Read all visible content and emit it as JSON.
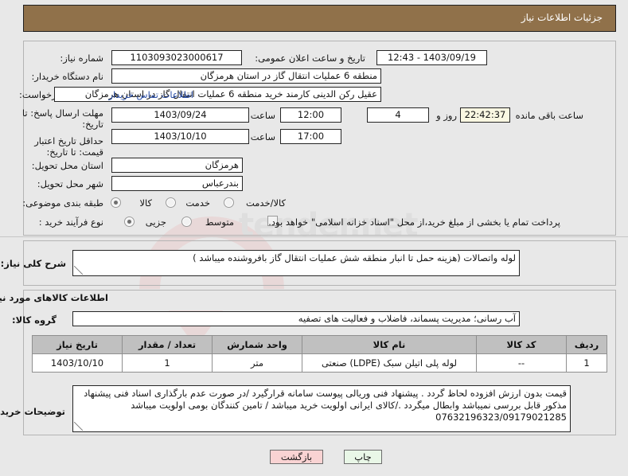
{
  "header": {
    "title": "جزئیات اطلاعات نیاز"
  },
  "request_info": {
    "need_number_label": "شماره نیاز:",
    "need_number_value": "1103093023000617",
    "announce_datetime_label": "تاریخ و ساعت اعلان عمومی:",
    "announce_datetime_value": "1403/09/19 - 12:43",
    "buyer_org_label": "نام دستگاه خریدار:",
    "buyer_org_value": "منطقه 6 عملیات انتقال گاز در استان هرمزگان",
    "requester_label": "ایجاد کننده درخواست:",
    "requester_value": "عقیل رکن الدینی کارمند خرید منطقه 6 عملیات انتقال گاز در استان هرمزگان",
    "buyer_contact_link": "اطلاعات تماس خریدار",
    "response_deadline_label": "مهلت ارسال پاسخ: تا تاریخ:",
    "response_deadline_date": "1403/09/24",
    "response_deadline_time_label": "ساعت",
    "response_deadline_time": "12:00",
    "remaining_days": "4",
    "remaining_days_label": "روز و",
    "remaining_time": "22:42:37",
    "remaining_time_label": "ساعت باقی مانده",
    "price_validity_label": "حداقل تاریخ اعتبار قیمت: تا تاریخ:",
    "price_validity_date": "1403/10/10",
    "price_validity_time_label": "ساعت",
    "price_validity_time": "17:00",
    "delivery_province_label": "استان محل تحویل:",
    "delivery_province_value": "هرمزگان",
    "delivery_city_label": "شهر محل تحویل:",
    "delivery_city_value": "بندرعباس",
    "subject_category_label": "طبقه بندی موضوعی:",
    "subject_options": [
      {
        "label": "کالا",
        "selected": true
      },
      {
        "label": "خدمت",
        "selected": false
      },
      {
        "label": "کالا/خدمت",
        "selected": false
      }
    ],
    "purchase_type_label": "نوع فرآیند خرید :",
    "purchase_options": [
      {
        "label": "جزیی",
        "selected": true
      },
      {
        "label": "متوسط",
        "selected": false
      }
    ],
    "treasury_checkbox_label": "پرداخت تمام یا بخشی از مبلغ خرید،از محل \"اسناد خزانه اسلامی\" خواهد بود.",
    "treasury_checked": false
  },
  "description": {
    "label": "شرح کلی نیاز:",
    "value": "لوله واتصالات (هزینه حمل تا انبار منطقه شش عملیات انتقال گاز بافروشنده میباشد )"
  },
  "goods": {
    "section_title": "اطلاعات کالاهای مورد نیاز",
    "group_label": "گروه کالا:",
    "group_value": "آب رسانی؛ مدیریت پسماند، فاضلاب و فعالیت های تصفیه",
    "table": {
      "columns": [
        "ردیف",
        "کد کالا",
        "نام کالا",
        "واحد شمارش",
        "تعداد / مقدار",
        "تاریخ نیاز"
      ],
      "rows": [
        [
          "1",
          "--",
          "لوله پلی اتیلن سبک (LDPE) صنعتی",
          "متر",
          "1",
          "1403/10/10"
        ]
      ]
    },
    "notes_label": "توضیحات خریدار:",
    "notes_value": "قیمت بدون ارزش افزوده لحاظ گردد . پیشنهاد فنی وریالی پیوست سامانه قرارگیرد /در صورت عدم بارگذاری اسناد فنی پیشنهاد مذکور قابل بررسی نمیباشد وابطال میگردد ./کالای ایرانی اولویت خرید میباشد / تامین کنندگان بومی اولویت میباشد 07632196323/09179021285"
  },
  "footer": {
    "print_label": "چاپ",
    "back_label": "بازگشت"
  },
  "theme": {
    "header_bg": "#90714a",
    "link_color": "#2b4fa8",
    "print_button_bg": "#e9f7e7",
    "back_button_bg": "#f9d3d3",
    "table_header_bg": "#c0c0c0",
    "page_bg": "#e8e8e8"
  },
  "watermark": {
    "text": "tender.net"
  }
}
